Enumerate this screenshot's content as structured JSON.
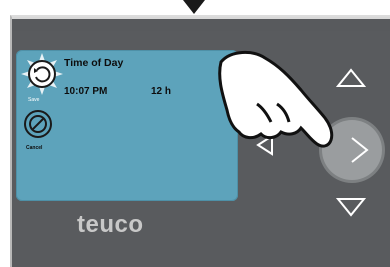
{
  "screen": {
    "title": "Time of Day",
    "time": "10:07 PM",
    "format": "12 h",
    "save_label": "Save",
    "cancel_label": "Cancel"
  },
  "brand": {
    "logo_text": "teuco"
  },
  "controls": {
    "up_icon": "triangle-up-icon",
    "down_icon": "triangle-down-icon",
    "left_icon": "triangle-left-icon",
    "right_icon": "triangle-right-icon"
  },
  "colors": {
    "panel": "#595b5e",
    "screen": "#5da3bb",
    "logo": "#c8c8c8",
    "button_outline": "#ffffff"
  }
}
